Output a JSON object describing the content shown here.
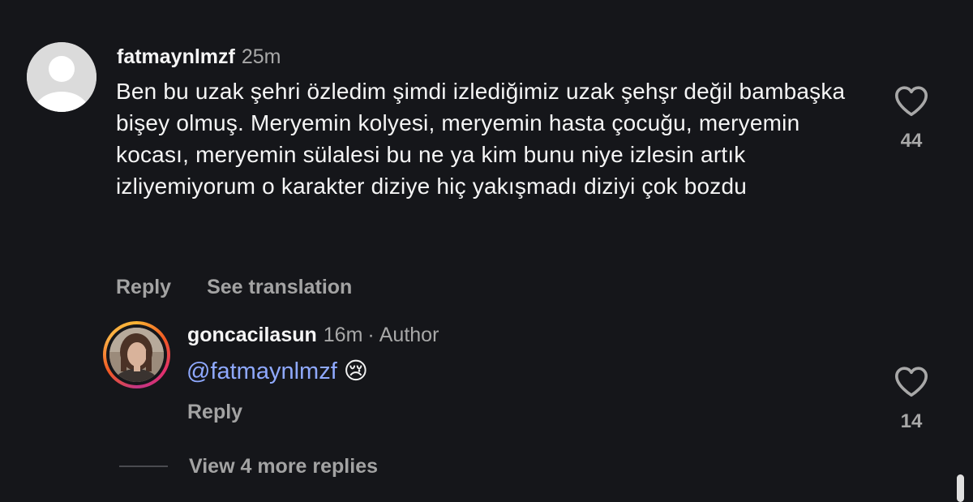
{
  "comments": [
    {
      "username": "fatmaynlmzf",
      "time": "25m",
      "text": "Ben bu uzak şehri özledim şimdi izlediğimiz uzak şehşr değil bambaşka bişey olmuş. Meryemin kolyesi, meryemin hasta çocuğu, meryemin kocası, meryemin sülalesi bu ne ya kim bunu niye izlesin artık izliyemiyorum o karakter diziye hiç yakışmadı diziyi çok bozdu",
      "reply_label": "Reply",
      "translation_label": "See translation",
      "like_count": "44",
      "avatar_icon": "default-user-icon",
      "liked": false
    },
    {
      "username": "goncacilasun",
      "time": "16m",
      "separator": "·",
      "badge": "Author",
      "mention": "@fatmaynlmzf",
      "emoji": "😢",
      "reply_label": "Reply",
      "like_count": "14",
      "avatar_icon": "profile-photo",
      "story_ring": true,
      "liked": false
    }
  ],
  "view_more_replies": "View 4 more replies",
  "colors": {
    "background": "#15161a",
    "text": "#f5f5f5",
    "muted": "#a8a8a8",
    "mention": "#8fa9ff"
  }
}
